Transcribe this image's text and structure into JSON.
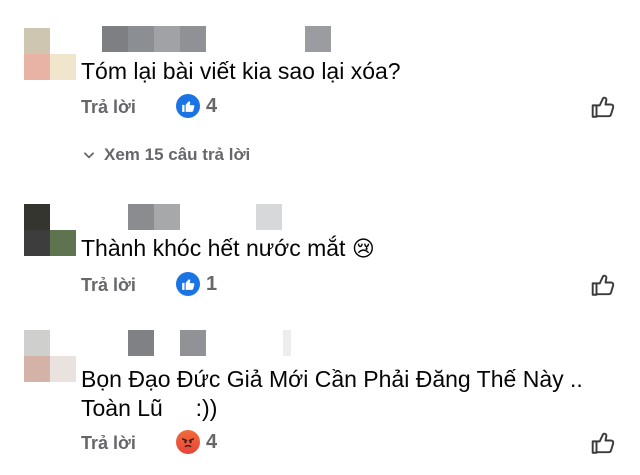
{
  "comments": [
    {
      "text": "Tóm lại bài viết kia sao lại xóa?",
      "reply_label": "Trả lời",
      "reaction": "like",
      "reaction_count": "4",
      "view_replies": "Xem 15 câu trả lời"
    },
    {
      "text": "Thành khóc hết nước mắt",
      "emoji": "😢",
      "reply_label": "Trả lời",
      "reaction": "like",
      "reaction_count": "1"
    },
    {
      "line1": "Bọn Đạo Đức Giả Mới Cần Phải Đăng Thế Này ..",
      "line2": "Toàn Lũ",
      "line2_tail": ":))",
      "reply_label": "Trả lời",
      "reaction": "angry",
      "reaction_count": "4"
    }
  ],
  "colors": {
    "like_blue": "#1b74e4",
    "angry_orange": "#f26b3a",
    "meta_gray": "#65676b"
  }
}
